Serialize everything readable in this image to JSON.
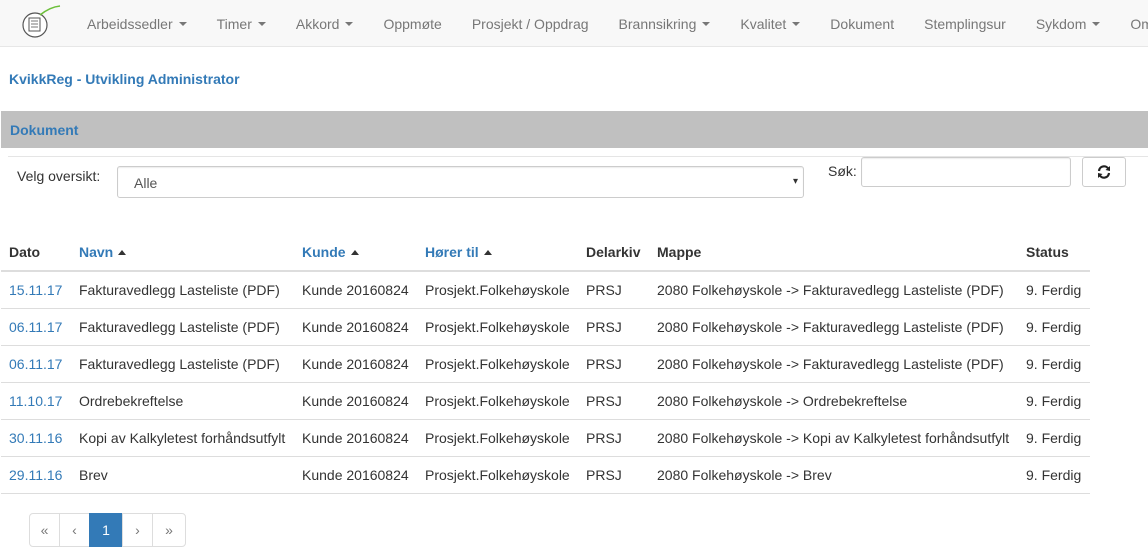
{
  "nav": {
    "items": [
      {
        "label": "Arbeidssedler",
        "dropdown": true
      },
      {
        "label": "Timer",
        "dropdown": true
      },
      {
        "label": "Akkord",
        "dropdown": true
      },
      {
        "label": "Oppmøte",
        "dropdown": false
      },
      {
        "label": "Prosjekt / Oppdrag",
        "dropdown": false
      },
      {
        "label": "Brannsikring",
        "dropdown": true
      },
      {
        "label": "Kvalitet",
        "dropdown": true
      },
      {
        "label": "Dokument",
        "dropdown": false
      },
      {
        "label": "Stemplingsur",
        "dropdown": false
      },
      {
        "label": "Sykdom",
        "dropdown": true
      },
      {
        "label": "Om",
        "dropdown": false
      }
    ]
  },
  "app_title": "KvikkReg - Utvikling Administrator",
  "section_title": "Dokument",
  "filter": {
    "label": "Velg oversikt:",
    "selected": "Alle"
  },
  "search": {
    "label": "Søk:",
    "value": ""
  },
  "table": {
    "columns": [
      "Dato",
      "Navn",
      "Kunde",
      "Hører til",
      "Delarkiv",
      "Mappe",
      "Status"
    ],
    "rows": [
      [
        "15.11.17",
        "Fakturavedlegg Lasteliste (PDF)",
        "Kunde 20160824",
        "Prosjekt.Folkehøyskole",
        "PRSJ",
        "2080 Folkehøyskole -> Fakturavedlegg Lasteliste (PDF)",
        "9. Ferdig"
      ],
      [
        "06.11.17",
        "Fakturavedlegg Lasteliste (PDF)",
        "Kunde 20160824",
        "Prosjekt.Folkehøyskole",
        "PRSJ",
        "2080 Folkehøyskole -> Fakturavedlegg Lasteliste (PDF)",
        "9. Ferdig"
      ],
      [
        "06.11.17",
        "Fakturavedlegg Lasteliste (PDF)",
        "Kunde 20160824",
        "Prosjekt.Folkehøyskole",
        "PRSJ",
        "2080 Folkehøyskole -> Fakturavedlegg Lasteliste (PDF)",
        "9. Ferdig"
      ],
      [
        "11.10.17",
        "Ordrebekreftelse",
        "Kunde 20160824",
        "Prosjekt.Folkehøyskole",
        "PRSJ",
        "2080 Folkehøyskole -> Ordrebekreftelse",
        "9. Ferdig"
      ],
      [
        "30.11.16",
        "Kopi av Kalkyletest forhåndsutfylt",
        "Kunde 20160824",
        "Prosjekt.Folkehøyskole",
        "PRSJ",
        "2080 Folkehøyskole -> Kopi av Kalkyletest forhåndsutfylt",
        "9. Ferdig"
      ],
      [
        "29.11.16",
        "Brev",
        "Kunde 20160824",
        "Prosjekt.Folkehøyskole",
        "PRSJ",
        "2080 Folkehøyskole -> Brev",
        "9. Ferdig"
      ]
    ]
  },
  "pagination": {
    "first": "«",
    "prev": "‹",
    "current": "1",
    "next": "›",
    "last": "»"
  },
  "icons": {
    "logo": "document-logo-icon",
    "refresh": "refresh-icon",
    "select_arrow": "chevron-down-icon"
  },
  "colors": {
    "link": "#337ab7",
    "section_bar": "#c0c0c0",
    "active_page": "#337ab7"
  }
}
